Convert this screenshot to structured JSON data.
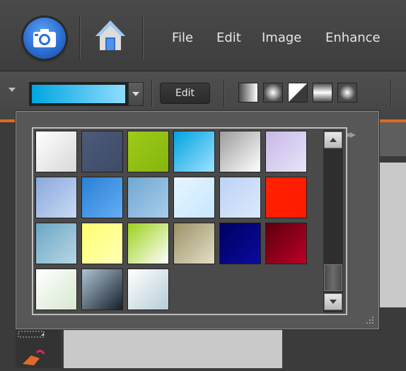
{
  "menubar": {
    "items": [
      "File",
      "Edit",
      "Image",
      "Enhance"
    ]
  },
  "options": {
    "edit_label": "Edit",
    "selected_gradient": "blue-cyan",
    "gradient_types": [
      "linear-icon",
      "radial-icon",
      "angle-icon",
      "reflected-icon",
      "diamond-icon"
    ]
  },
  "icons": {
    "camera": "camera-icon",
    "home": "home-icon",
    "fly_menu": "fly-menu-icon"
  },
  "swatches": [
    [
      "#ffffff",
      "#d8d8d8"
    ],
    [
      "#4d5a79",
      "#3d4a68"
    ],
    [
      "#9dcc18",
      "#86b40e"
    ],
    [
      "#00a3df",
      "#9ee2ff"
    ],
    [
      "#9c9c9c",
      "#ffffff"
    ],
    [
      "#c7b8e8",
      "#e9e4f7"
    ],
    [
      "#8aa9dc",
      "#c9d9f4"
    ],
    [
      "#2a7fd6",
      "#64aef4"
    ],
    [
      "#6fa7d3",
      "#a9cde8"
    ],
    [
      "#e7f5ff",
      "#c7e7ff"
    ],
    [
      "#bcd2f5",
      "#dce9fb"
    ],
    [
      "#ff2200",
      "#ff1a00"
    ],
    [
      "#6ba6c4",
      "#b7d7e4"
    ],
    [
      "#ffff6e",
      "#ffffb8"
    ],
    [
      "#9cd11a",
      "#ffffff"
    ],
    [
      "#9c9267",
      "#e3dfc6"
    ],
    [
      "#000060",
      "#0a0aa0"
    ],
    [
      "#5c0010",
      "#bb0025"
    ],
    [
      "#ffffff",
      "#d6e8d0"
    ],
    [
      "#b0c4d4",
      "#14202a"
    ],
    [
      "#ffffff",
      "#b5cdd6"
    ]
  ]
}
